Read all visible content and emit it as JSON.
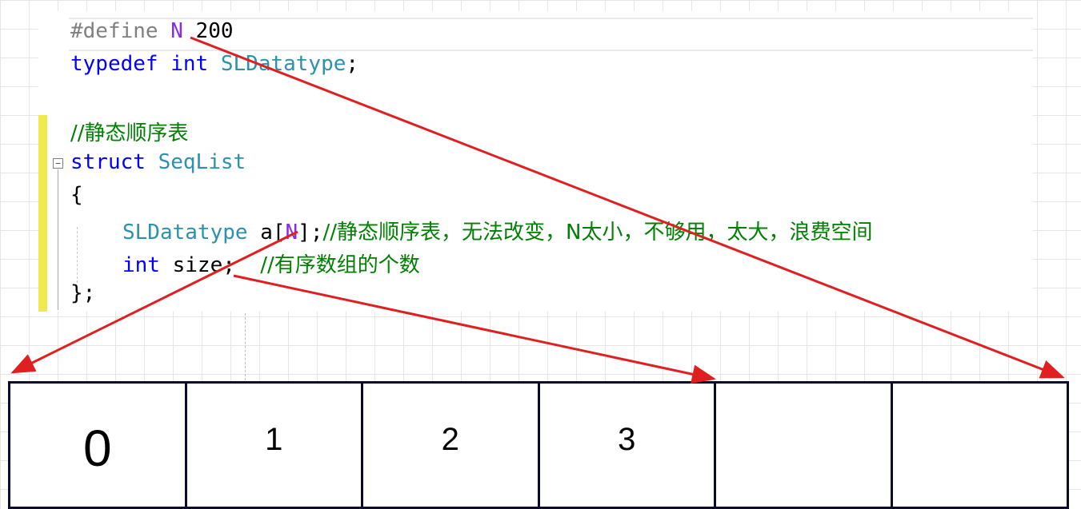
{
  "code": {
    "define_kw": "#define",
    "define_macro": "N",
    "define_value": " 200",
    "typedef_kw": "typedef",
    "typedef_type": "int",
    "typedef_name": "SLDatatype",
    "semicolon": ";",
    "comment_title": "//静态顺序表",
    "struct_kw": "struct",
    "struct_name": "SeqList",
    "open_brace": "{",
    "field1_type": "SLDatatype",
    "field1_name": " a",
    "field1_bracket_open": "[",
    "field1_macro": "N",
    "field1_bracket_close": "];",
    "field1_comment": "//静态顺序表，无法改变，N太小，不够用，太大，浪费空间",
    "field2_type": "int",
    "field2_rest": " size;  ",
    "field2_comment": "//有序数组的个数",
    "close_brace": "};",
    "collapse_symbol": "−"
  },
  "array_cells": [
    "0",
    "1",
    "2",
    "3",
    "",
    ""
  ],
  "colors": {
    "keyword": "#0000ff",
    "type": "#2b91af",
    "macro": "#8a2be2",
    "comment": "#008000",
    "arrow": "#e02020",
    "cell_border": "#0b0b2e",
    "highlight_bar": "#f1ea4d"
  }
}
